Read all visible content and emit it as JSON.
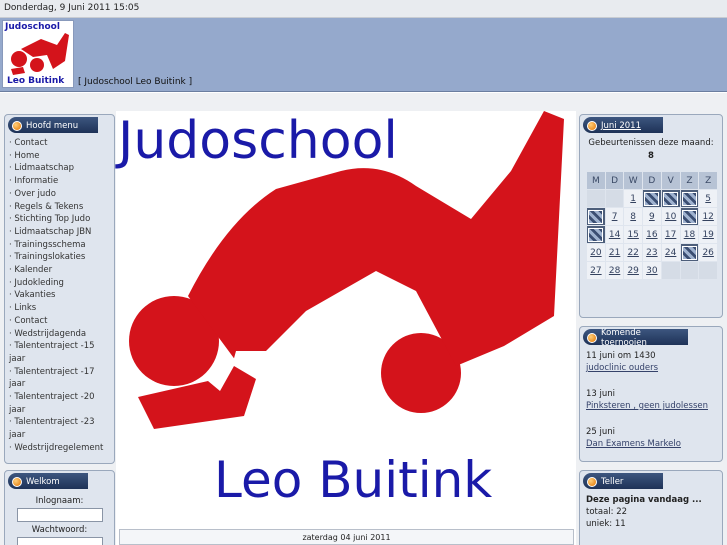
{
  "topbar": {
    "date": "Donderdag, 9 Juni 2011 15:05"
  },
  "header": {
    "logo_line1": "Judoschool",
    "logo_line2": "Leo Buitink",
    "tagline": "[ Judoschool Leo Buitink ]"
  },
  "menu": {
    "title": "Hoofd menu",
    "items": [
      "· Contact",
      "· Home",
      "· Lidmaatschap",
      "· Informatie",
      "· Over judo",
      "· Regels & Tekens",
      "· Stichting Top Judo",
      "· Lidmaatschap JBN",
      "· Trainingsschema",
      "· Trainingslokaties",
      "· Kalender",
      "· Judokleding",
      "· Vakanties",
      "· Links",
      "· Contact",
      "· Wedstrijdagenda",
      "· Talententraject -15 jaar",
      "· Talententraject -17 jaar",
      "· Talententraject -20 jaar",
      "· Talententraject -23 jaar",
      "· Wedstrijdregelement"
    ]
  },
  "login": {
    "title": "Welkom",
    "username_label": "Inlognaam:",
    "password_label": "Wachtwoord:"
  },
  "banner": {
    "line1": "Judoschool",
    "line2": "Leo Buitink"
  },
  "news": {
    "date": "zaterdag 04 juni 2011"
  },
  "calendar": {
    "title": "Juni 2011",
    "events_label": "Gebeurtenissen deze maand:",
    "events_count": "8",
    "weekdays": [
      "M",
      "D",
      "W",
      "D",
      "V",
      "Z",
      "Z"
    ],
    "weeks": [
      [
        "",
        "",
        "1",
        "2*",
        "3*",
        "4*",
        "5"
      ],
      [
        "6*",
        "7",
        "8",
        "9",
        "10",
        "11*",
        "12"
      ],
      [
        "13*",
        "14",
        "15",
        "16",
        "17",
        "18",
        "19"
      ],
      [
        "20",
        "21",
        "22",
        "23",
        "24",
        "25*",
        "26"
      ],
      [
        "27",
        "28",
        "29",
        "30",
        "",
        "",
        ""
      ]
    ]
  },
  "tournaments": {
    "title": "Komende toernooien",
    "items": [
      {
        "date": "11 juni om 1430",
        "link": "judoclinic ouders"
      },
      {
        "date": "13 juni",
        "link": "Pinksteren , geen judolessen"
      },
      {
        "date": "25 juni",
        "link": "Dan Examens Markelo"
      }
    ]
  },
  "counter": {
    "title": "Teller",
    "today_label": "Deze pagina vandaag ...",
    "total": "totaal: 22",
    "unique": "uniek: 11"
  }
}
